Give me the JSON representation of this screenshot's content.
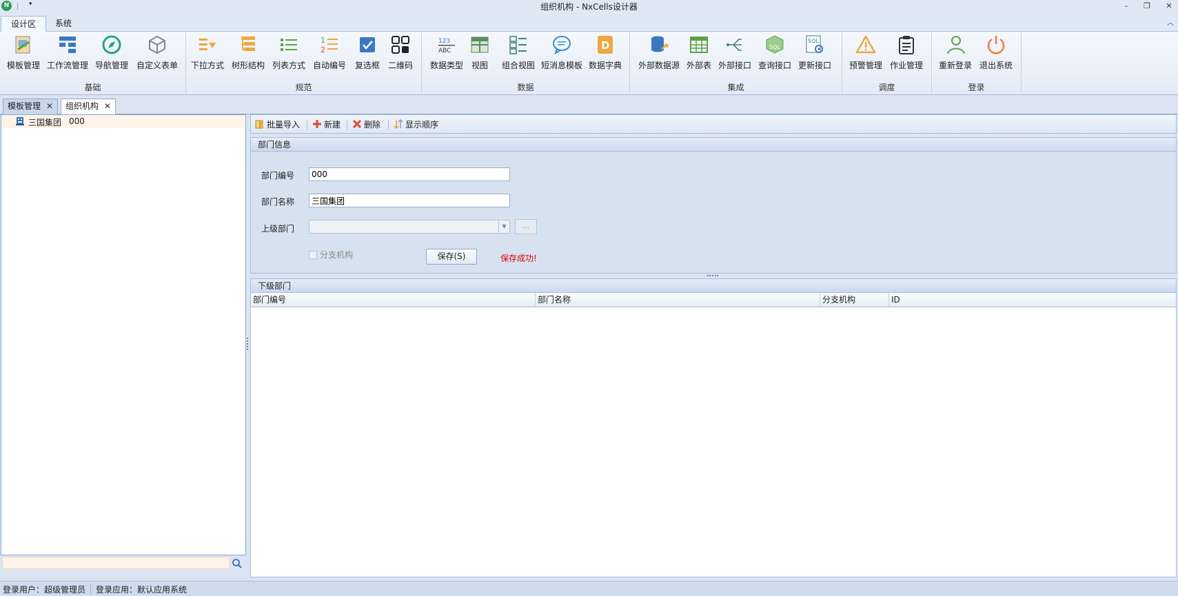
{
  "window": {
    "title": "组织机构 - NxCells设计器",
    "app_icon_letter": "N"
  },
  "ribbon_tabs": [
    "设计区",
    "系统"
  ],
  "ribbon_groups": [
    {
      "label": "基础",
      "buttons": [
        "模板管理",
        "工作流管理",
        "导航管理",
        "自定义表单"
      ]
    },
    {
      "label": "规范",
      "buttons": [
        "下拉方式",
        "树形结构",
        "列表方式",
        "自动编号",
        "复选框",
        "二维码"
      ]
    },
    {
      "label": "数据",
      "buttons": [
        "数据类型",
        "视图",
        "组合视图",
        "短消息模板",
        "数据字典"
      ]
    },
    {
      "label": "集成",
      "buttons": [
        "外部数据源",
        "外部表",
        "外部接口",
        "查询接口",
        "更新接口"
      ]
    },
    {
      "label": "调度",
      "buttons": [
        "预警管理",
        "作业管理"
      ]
    },
    {
      "label": "登录",
      "buttons": [
        "重新登录",
        "退出系统"
      ]
    }
  ],
  "doc_tabs": [
    "模板管理",
    "组织机构"
  ],
  "tree": {
    "root_label": "三国集团",
    "root_code": "000"
  },
  "search": {
    "placeholder": ""
  },
  "toolbar": {
    "import_label": "批量导入",
    "new_label": "新建",
    "delete_label": "删除",
    "order_label": "显示顺序"
  },
  "dept_info": {
    "header": "部门信息",
    "code_label": "部门编号",
    "code_value": "000",
    "name_label": "部门名称",
    "name_value": "三国集团",
    "parent_label": "上级部门",
    "parent_value": "",
    "ellipsis": "...",
    "branch_label": "分支机构",
    "branch_checked": false,
    "save_label": "保存(S)",
    "save_message": "保存成功!"
  },
  "sub_depts": {
    "header": "下级部门",
    "columns": [
      "部门编号",
      "部门名称",
      "分支机构",
      "ID"
    ],
    "rows": []
  },
  "statusbar": {
    "user_label": "登录用户：超级管理员",
    "app_label": "登录应用：默认应用系统"
  },
  "colors": {
    "accent": "#2e9b56",
    "error_text": "#e00000",
    "selection": "#fff3ea"
  }
}
